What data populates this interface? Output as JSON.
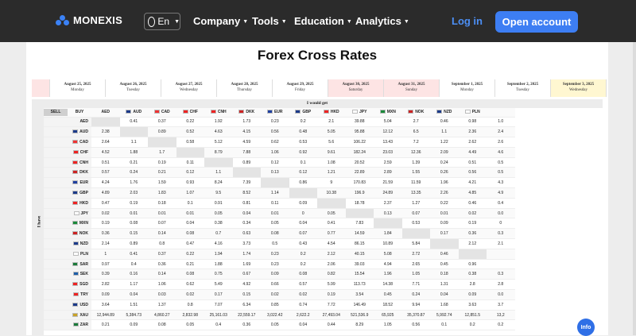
{
  "nav": {
    "brand": "MONEXIS",
    "lang": "En",
    "menu": [
      "Company",
      "Tools",
      "Education",
      "Analytics"
    ],
    "login": "Log in",
    "open_account": "Open account",
    "brand_color": "#3d7ef3"
  },
  "title": "Forex Cross Rates",
  "dates": [
    {
      "date": "August 25, 2025",
      "day": "Monday",
      "kind": "weekday"
    },
    {
      "date": "August 26, 2025",
      "day": "Tuesday",
      "kind": "weekday"
    },
    {
      "date": "August 27, 2025",
      "day": "Wednesday",
      "kind": "weekday"
    },
    {
      "date": "August 28, 2025",
      "day": "Thursday",
      "kind": "weekday"
    },
    {
      "date": "August 29, 2025",
      "day": "Friday",
      "kind": "weekday"
    },
    {
      "date": "August 30, 2025",
      "day": "Saturday",
      "kind": "weekend"
    },
    {
      "date": "August 31, 2025",
      "day": "Sunday",
      "kind": "weekend"
    },
    {
      "date": "September 1, 2025",
      "day": "Monday",
      "kind": "weekday"
    },
    {
      "date": "September 2, 2025",
      "day": "Tuesday",
      "kind": "weekday"
    },
    {
      "date": "September 3, 2025",
      "day": "Wednesday",
      "kind": "today"
    }
  ],
  "table": {
    "i_would_get": "I would get",
    "i_have": "I have",
    "sell": "SELL",
    "buy": "BUY",
    "columns": [
      "AED",
      "AUD",
      "CAD",
      "CHF",
      "CNH",
      "DKK",
      "EUR",
      "GBP",
      "HKD",
      "JPY",
      "MXN",
      "NOK",
      "NZD",
      "PLN",
      ""
    ],
    "rows": [
      {
        "cur": "AED",
        "vals": [
          "",
          "0.41",
          "0.37",
          "0.22",
          "1.92",
          "1.73",
          "0.23",
          "0.2",
          "2.1",
          "39.88",
          "5.04",
          "2.7",
          "0.46",
          "0.98",
          "1.0"
        ]
      },
      {
        "cur": "AUD",
        "vals": [
          "2.38",
          "",
          "0.89",
          "0.52",
          "4.63",
          "4.15",
          "0.56",
          "0.48",
          "5.05",
          "95.88",
          "12.12",
          "6.5",
          "1.1",
          "2.36",
          "2.4"
        ]
      },
      {
        "cur": "CAD",
        "vals": [
          "2.64",
          "1.1",
          "",
          "0.58",
          "5.12",
          "4.59",
          "0.62",
          "0.53",
          "5.6",
          "106.22",
          "13.43",
          "7.2",
          "1.22",
          "2.62",
          "2.6"
        ]
      },
      {
        "cur": "CHF",
        "vals": [
          "4.52",
          "1.88",
          "1.7",
          "",
          "8.79",
          "7.88",
          "1.06",
          "0.92",
          "9.61",
          "182.24",
          "23.03",
          "12.36",
          "2.09",
          "4.49",
          "4.6"
        ]
      },
      {
        "cur": "CNH",
        "vals": [
          "0.51",
          "0.21",
          "0.19",
          "0.11",
          "",
          "0.89",
          "0.12",
          "0.1",
          "1.08",
          "20.52",
          "2.59",
          "1.39",
          "0.24",
          "0.51",
          "0.5"
        ]
      },
      {
        "cur": "DKK",
        "vals": [
          "0.57",
          "0.24",
          "0.21",
          "0.12",
          "1.1",
          "",
          "0.13",
          "0.12",
          "1.21",
          "22.89",
          "2.89",
          "1.55",
          "0.26",
          "0.56",
          "0.5"
        ]
      },
      {
        "cur": "EUR",
        "vals": [
          "4.24",
          "1.76",
          "1.59",
          "0.93",
          "8.24",
          "7.39",
          "",
          "0.86",
          "9",
          "170.83",
          "21.59",
          "11.59",
          "1.96",
          "4.21",
          "4.3"
        ]
      },
      {
        "cur": "GBP",
        "vals": [
          "4.89",
          "2.03",
          "1.83",
          "1.07",
          "9.5",
          "8.52",
          "1.14",
          "",
          "10.38",
          "196.9",
          "24.89",
          "13.35",
          "2.26",
          "4.85",
          "4.9"
        ]
      },
      {
        "cur": "HKD",
        "vals": [
          "0.47",
          "0.19",
          "0.18",
          "0.1",
          "0.91",
          "0.81",
          "0.11",
          "0.09",
          "",
          "18.78",
          "2.37",
          "1.27",
          "0.22",
          "0.46",
          "0.4"
        ]
      },
      {
        "cur": "JPY",
        "vals": [
          "0.02",
          "0.01",
          "0.01",
          "0.01",
          "0.05",
          "0.04",
          "0.01",
          "0",
          "0.05",
          "",
          "0.13",
          "0.07",
          "0.01",
          "0.02",
          "0.0"
        ]
      },
      {
        "cur": "MXN",
        "vals": [
          "0.19",
          "0.08",
          "0.07",
          "0.04",
          "0.38",
          "0.34",
          "0.05",
          "0.04",
          "0.41",
          "7.83",
          "",
          "0.53",
          "0.09",
          "0.19",
          "0"
        ]
      },
      {
        "cur": "NOK",
        "vals": [
          "0.36",
          "0.15",
          "0.14",
          "0.08",
          "0.7",
          "0.63",
          "0.08",
          "0.07",
          "0.77",
          "14.59",
          "1.84",
          "",
          "0.17",
          "0.36",
          "0.3"
        ]
      },
      {
        "cur": "NZD",
        "vals": [
          "2.14",
          "0.89",
          "0.8",
          "0.47",
          "4.16",
          "3.73",
          "0.5",
          "0.43",
          "4.54",
          "86.15",
          "10.89",
          "5.84",
          "",
          "2.12",
          "2.1"
        ]
      },
      {
        "cur": "PLN",
        "vals": [
          "1",
          "0.41",
          "0.37",
          "0.22",
          "1.94",
          "1.74",
          "0.23",
          "0.2",
          "2.12",
          "40.15",
          "5.08",
          "2.72",
          "0.46",
          "",
          ""
        ]
      },
      {
        "cur": "SAR",
        "vals": [
          "0.97",
          "0.4",
          "0.36",
          "0.21",
          "1.88",
          "1.69",
          "0.23",
          "0.2",
          "2.06",
          "39.03",
          "4.94",
          "2.65",
          "0.45",
          "0.96",
          ""
        ]
      },
      {
        "cur": "SEK",
        "vals": [
          "0.39",
          "0.16",
          "0.14",
          "0.08",
          "0.75",
          "0.67",
          "0.09",
          "0.08",
          "0.82",
          "15.54",
          "1.96",
          "1.05",
          "0.18",
          "0.38",
          "0.3"
        ]
      },
      {
        "cur": "SGD",
        "vals": [
          "2.82",
          "1.17",
          "1.06",
          "0.62",
          "5.49",
          "4.92",
          "0.66",
          "0.57",
          "5.99",
          "113.73",
          "14.38",
          "7.71",
          "1.31",
          "2.8",
          "2.8"
        ]
      },
      {
        "cur": "TRY",
        "vals": [
          "0.09",
          "0.04",
          "0.03",
          "0.02",
          "0.17",
          "0.15",
          "0.02",
          "0.02",
          "0.19",
          "3.54",
          "0.45",
          "0.24",
          "0.04",
          "0.09",
          "0.0"
        ]
      },
      {
        "cur": "USD",
        "vals": [
          "3.64",
          "1.51",
          "1.37",
          "0.8",
          "7.07",
          "6.34",
          "0.85",
          "0.74",
          "7.72",
          "146.49",
          "18.52",
          "9.94",
          "1.68",
          "3.63",
          "3.7"
        ]
      },
      {
        "cur": "XAU",
        "vals": [
          "12,944.89",
          "5,384.73",
          "4,860.27",
          "2,832.98",
          "25,161.03",
          "22,559.17",
          "3,022.42",
          "2,622.2",
          "27,493.04",
          "521,536.9",
          "65,925",
          "35,370.87",
          "5,992.74",
          "12,851.5",
          "13,2"
        ]
      },
      {
        "cur": "ZAR",
        "vals": [
          "0.21",
          "0.09",
          "0.08",
          "0.05",
          "0.4",
          "0.36",
          "0.05",
          "0.04",
          "0.44",
          "8.29",
          "1.05",
          "0.56",
          "0.1",
          "0.2",
          "0.2"
        ]
      }
    ]
  },
  "info_button": "Info"
}
